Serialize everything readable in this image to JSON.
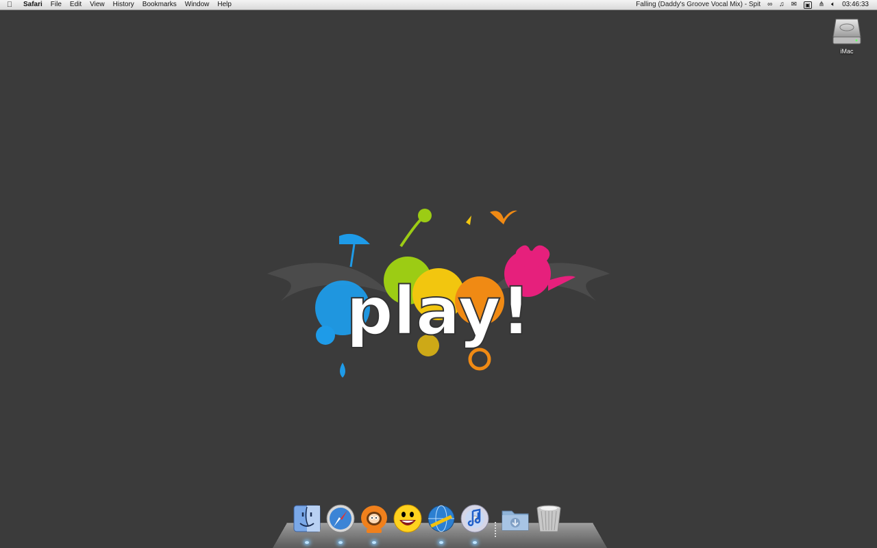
{
  "menubar": {
    "apple_icon": "apple-logo-icon",
    "app_name": "Safari",
    "items": [
      "File",
      "Edit",
      "View",
      "History",
      "Bookmarks",
      "Window",
      "Help"
    ]
  },
  "status": {
    "now_playing": "Falling (Daddy's Groove Vocal Mix) - Spit",
    "clock": "03:46:33",
    "icons": [
      "script-menu-icon",
      "music-note-icon",
      "mail-icon",
      "screen-icon",
      "bluetooth-icon",
      "volume-icon",
      "clock-icon"
    ]
  },
  "desktop": {
    "hd_label": "iMac",
    "hd_icon": "hard-drive-icon"
  },
  "wallpaper": {
    "text": "play!",
    "colors": [
      "#1e9be8",
      "#9ccc14",
      "#f2c60f",
      "#f08a14",
      "#e6207c"
    ]
  },
  "dock": {
    "apps": [
      {
        "name": "Finder",
        "icon": "finder-icon",
        "running": true
      },
      {
        "name": "Safari",
        "icon": "safari-compass-icon",
        "running": true
      },
      {
        "name": "Kenny",
        "icon": "kenny-character-icon",
        "running": true
      },
      {
        "name": "Yahoo Messenger",
        "icon": "smiley-face-icon",
        "running": false
      },
      {
        "name": "Network",
        "icon": "globe-icon",
        "running": true
      },
      {
        "name": "iTunes",
        "icon": "itunes-cd-icon",
        "running": true
      }
    ],
    "stacks": [
      {
        "name": "Downloads",
        "icon": "downloads-folder-icon"
      },
      {
        "name": "Trash",
        "icon": "trash-icon"
      }
    ]
  }
}
